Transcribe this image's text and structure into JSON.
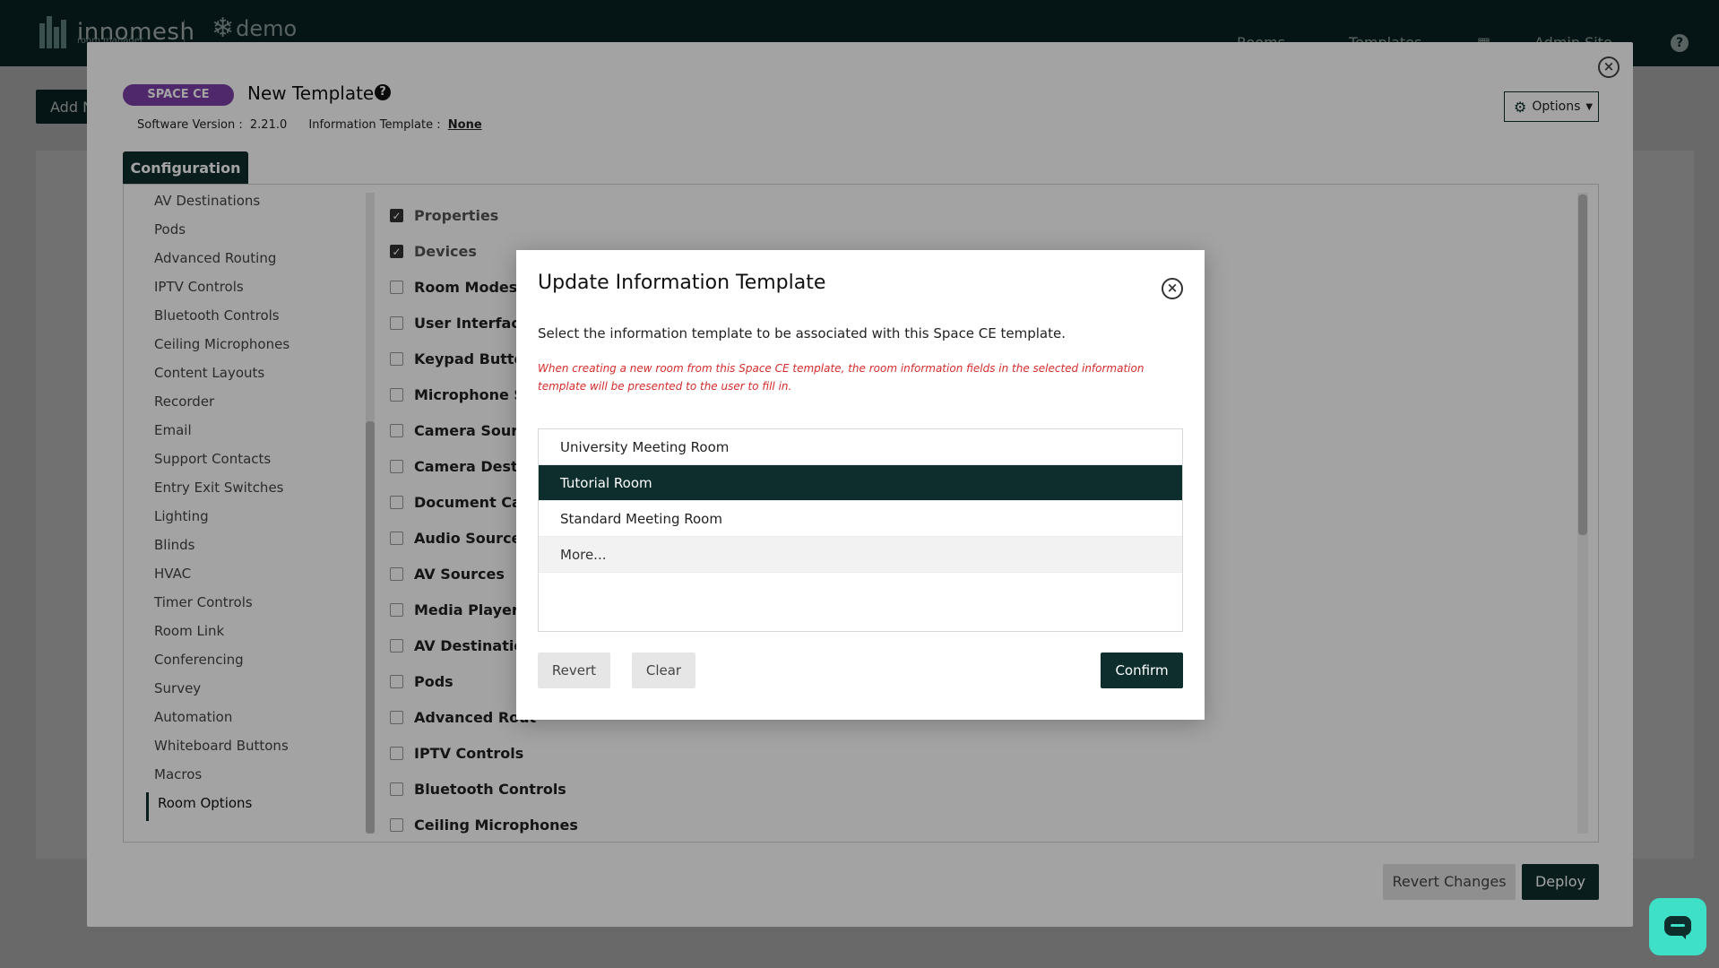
{
  "header": {
    "brand": "innomesh",
    "brand_sub": "room manager",
    "workspace": "demo",
    "nav": [
      "Rooms",
      "Templates",
      "Admin Site"
    ],
    "help": "?"
  },
  "background": {
    "add_button": "Add N"
  },
  "editor": {
    "badge": "SPACE CE",
    "title": "New Template",
    "help": "?",
    "software_version_label": "Software Version :",
    "software_version": "2.21.0",
    "info_template_label": "Information Template :",
    "info_template_value": "None",
    "options_label": "Options",
    "tab_configuration": "Configuration",
    "close": "×",
    "sidebar": [
      "AV Destinations",
      "Pods",
      "Advanced Routing",
      "IPTV Controls",
      "Bluetooth Controls",
      "Ceiling Microphones",
      "Content Layouts",
      "Recorder",
      "Email",
      "Support Contacts",
      "Entry Exit Switches",
      "Lighting",
      "Blinds",
      "HVAC",
      "Timer Controls",
      "Room Link",
      "Conferencing",
      "Survey",
      "Automation",
      "Whiteboard Buttons",
      "Macros",
      "Room Options"
    ],
    "sidebar_active": "Room Options",
    "checklist": [
      {
        "label": "Properties",
        "checked": true
      },
      {
        "label": "Devices",
        "checked": true
      },
      {
        "label": "Room Modes",
        "checked": false
      },
      {
        "label": "User Interfaces",
        "checked": false
      },
      {
        "label": "Keypad Buttons",
        "checked": false
      },
      {
        "label": "Microphone Sta",
        "checked": false
      },
      {
        "label": "Camera Source",
        "checked": false
      },
      {
        "label": "Camera Destina",
        "checked": false
      },
      {
        "label": "Document Cam",
        "checked": false
      },
      {
        "label": "Audio Sources",
        "checked": false
      },
      {
        "label": "AV Sources",
        "checked": false
      },
      {
        "label": "Media Player Co",
        "checked": false
      },
      {
        "label": "AV Destinations",
        "checked": false
      },
      {
        "label": "Pods",
        "checked": false
      },
      {
        "label": "Advanced Rout",
        "checked": false
      },
      {
        "label": "IPTV Controls",
        "checked": false
      },
      {
        "label": "Bluetooth Controls",
        "checked": false
      },
      {
        "label": "Ceiling Microphones",
        "checked": false
      }
    ],
    "revert_changes": "Revert Changes",
    "deploy": "Deploy"
  },
  "dialog": {
    "title": "Update Information Template",
    "close": "×",
    "description": "Select the information template to be associated with this Space CE template.",
    "warning": "When creating a new room from this Space CE template, the room information fields in the selected information template will be presented to the user to fill in.",
    "templates": [
      "University Meeting Room",
      "Tutorial Room",
      "Standard Meeting Room"
    ],
    "selected": "Tutorial Room",
    "more": "More...",
    "revert": "Revert",
    "clear": "Clear",
    "confirm": "Confirm"
  },
  "colors": {
    "brand_dark": "#0d2e2d",
    "badge_purple": "#7b3fa6",
    "warning_red": "#d42c2c",
    "chat_teal": "#3ee0c8"
  }
}
